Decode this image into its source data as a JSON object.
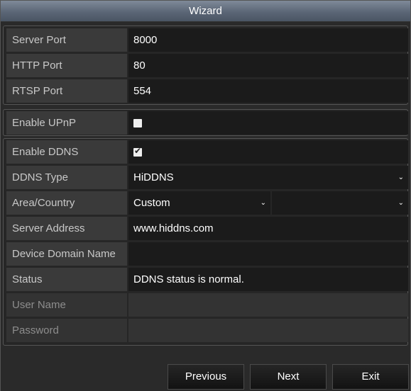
{
  "window": {
    "title": "Wizard"
  },
  "port_settings": {
    "server_port": {
      "label": "Server Port",
      "value": "8000"
    },
    "http_port": {
      "label": "HTTP Port",
      "value": "80"
    },
    "rtsp_port": {
      "label": "RTSP Port",
      "value": "554"
    }
  },
  "upnp": {
    "label": "Enable UPnP",
    "checked": false
  },
  "ddns": {
    "enable": {
      "label": "Enable DDNS",
      "checked": true
    },
    "type": {
      "label": "DDNS Type",
      "value": "HiDDNS"
    },
    "area": {
      "label": "Area/Country",
      "value": "Custom",
      "value2": ""
    },
    "server_address": {
      "label": "Server Address",
      "value": "www.hiddns.com"
    },
    "device_domain_name": {
      "label": "Device Domain Name",
      "value": ""
    },
    "status": {
      "label": "Status",
      "value": "DDNS status is normal."
    },
    "user_name": {
      "label": "User Name",
      "value": ""
    },
    "password": {
      "label": "Password",
      "value": ""
    }
  },
  "footer": {
    "previous": "Previous",
    "next": "Next",
    "exit": "Exit"
  },
  "icons": {
    "checkbox_checked": "check-icon",
    "dropdown": "chevron-down-icon"
  }
}
